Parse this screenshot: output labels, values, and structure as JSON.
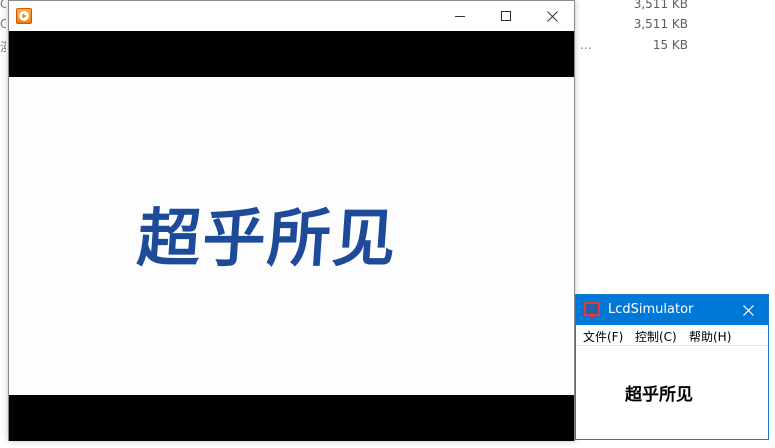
{
  "background_list": {
    "rows": [
      {
        "edge": "OF",
        "extra": "",
        "size": "3,511 KB"
      },
      {
        "edge": "OF",
        "extra": "",
        "size": "3,511 KB"
      },
      {
        "edge": "漫",
        "extra": "...",
        "size": "15 KB"
      }
    ]
  },
  "player": {
    "icons": {
      "app": "play-icon",
      "minimize": "minimize-icon",
      "maximize": "maximize-icon",
      "close": "close-icon"
    },
    "video_frame_text": "超乎所见"
  },
  "lcd_window": {
    "title": "LcdSimulator",
    "icons": {
      "app": "monitor-icon",
      "close": "close-icon"
    },
    "menu": {
      "file": "文件(F)",
      "control": "控制(C)",
      "help": "帮助(H)"
    },
    "display_text": "超乎所见"
  },
  "colors": {
    "accent": "#0078d7",
    "brand_text": "#1d4b9a",
    "letterbox": "#000000"
  }
}
